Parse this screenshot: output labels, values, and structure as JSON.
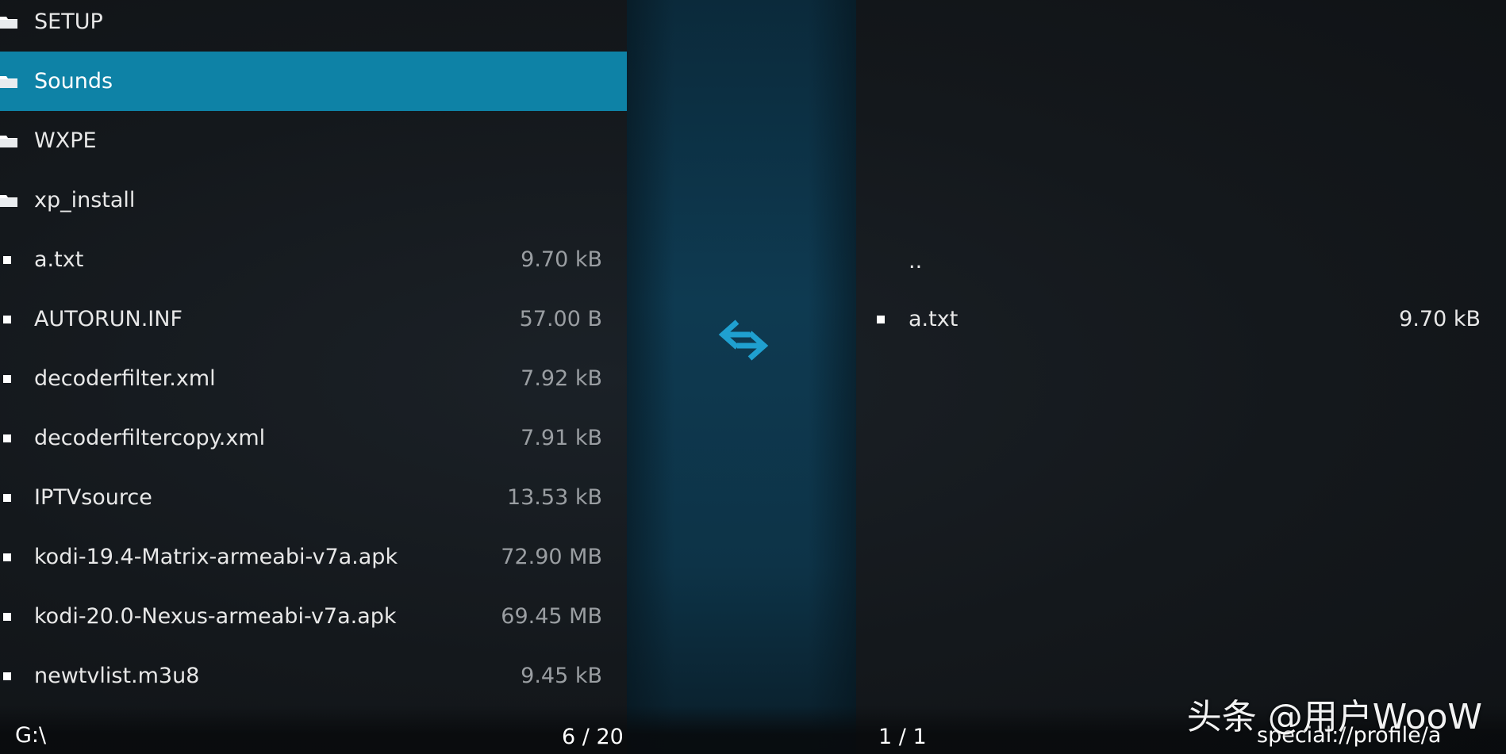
{
  "left_pane": {
    "items": [
      {
        "name": "SETUP",
        "type": "folder",
        "size": ""
      },
      {
        "name": "Sounds",
        "type": "folder",
        "size": "",
        "selected": true
      },
      {
        "name": "WXPE",
        "type": "folder",
        "size": ""
      },
      {
        "name": "xp_install",
        "type": "folder",
        "size": ""
      },
      {
        "name": "a.txt",
        "type": "file",
        "size": "9.70 kB"
      },
      {
        "name": "AUTORUN.INF",
        "type": "file",
        "size": "57.00 B"
      },
      {
        "name": "decoderfilter.xml",
        "type": "file",
        "size": "7.92 kB"
      },
      {
        "name": "decoderfiltercopy.xml",
        "type": "file",
        "size": "7.91 kB"
      },
      {
        "name": "IPTVsource",
        "type": "file",
        "size": "13.53 kB"
      },
      {
        "name": "kodi-19.4-Matrix-armeabi-v7a.apk",
        "type": "file",
        "size": "72.90 MB"
      },
      {
        "name": "kodi-20.0-Nexus-armeabi-v7a.apk",
        "type": "file",
        "size": "69.45 MB"
      },
      {
        "name": "newtvlist.m3u8",
        "type": "file",
        "size": "9.45 kB"
      }
    ],
    "path": "G:\\",
    "position": "6 / 20"
  },
  "middle": {
    "icon": "swap-arrows-icon",
    "accent_color": "#1fa0d0"
  },
  "right_pane": {
    "items": [
      {
        "name": "..",
        "type": "parent",
        "size": ""
      },
      {
        "name": "a.txt",
        "type": "file",
        "size": "9.70 kB"
      }
    ],
    "path": "special://profile/a",
    "position": "1 / 1"
  },
  "watermark": "头条 @用户WooW",
  "colors": {
    "selection": "#0e82a6",
    "background": "#14181c",
    "size_text": "#9a9ea2"
  }
}
